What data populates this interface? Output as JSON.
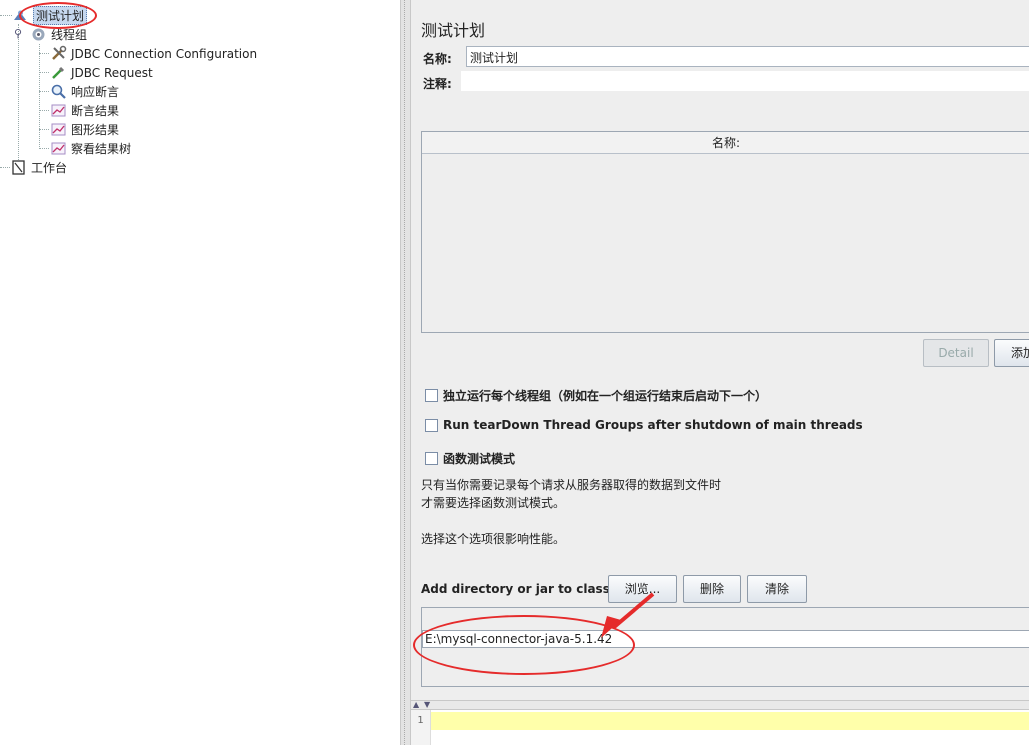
{
  "tree": {
    "root": "测试计划",
    "thread_group": "线程组",
    "children": [
      "JDBC Connection Configuration",
      "JDBC Request",
      "响应断言",
      "断言结果",
      "图形结果",
      "察看结果树"
    ],
    "workbench": "工作台"
  },
  "panel": {
    "title": "测试计划",
    "name_label": "名称:",
    "name_value": "测试计划",
    "comment_label": "注释:",
    "comment_value": "",
    "table_header": "名称:",
    "detail_button": "Detail",
    "add_button": "添加",
    "checkbox_1": "独立运行每个线程组（例如在一个组运行结束后启动下一个）",
    "checkbox_2": "Run tearDown Thread Groups after shutdown of main threads",
    "checkbox_3": "函数测试模式",
    "note_line_1": "只有当你需要记录每个请求从服务器取得的数据到文件时",
    "note_line_2": "才需要选择函数测试模式。",
    "note_line_3": "选择这个选项很影响性能。",
    "classpath_label": "Add directory or jar to classpath",
    "browse_button": "浏览...",
    "delete_button": "删除",
    "clear_button": "清除",
    "classpath_entry": "E:\\mysql-connector-java-5.1.42"
  },
  "log": {
    "line_number": "1"
  },
  "colors": {
    "annotation": "#e52b2b",
    "selection": "#c6d8ef",
    "log_highlight": "#ffffaa"
  }
}
